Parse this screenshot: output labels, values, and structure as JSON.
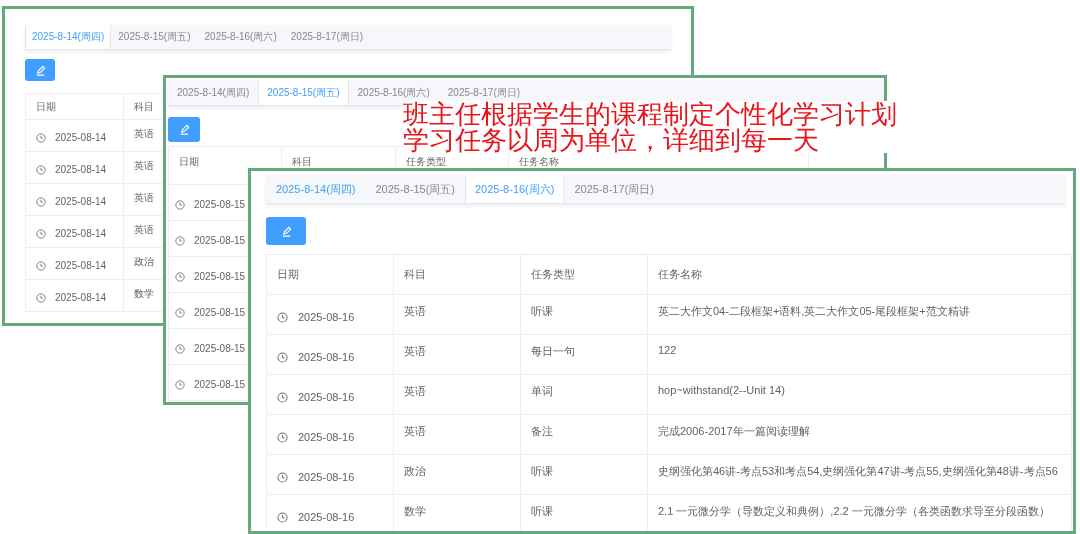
{
  "windows": [
    {
      "tabs": [
        {
          "label": "2025-8-14(周四)",
          "selected": true,
          "hovered": false
        },
        {
          "label": "2025-8-15(周五)",
          "selected": false,
          "hovered": false
        },
        {
          "label": "2025-8-16(周六)",
          "selected": false,
          "hovered": false
        },
        {
          "label": "2025-8-17(周日)",
          "selected": false,
          "hovered": false
        }
      ],
      "columns": [
        "日期",
        "科目"
      ],
      "rows": [
        [
          "2025-08-14",
          "英语"
        ],
        [
          "2025-08-14",
          "英语"
        ],
        [
          "2025-08-14",
          "英语"
        ],
        [
          "2025-08-14",
          "英语"
        ],
        [
          "2025-08-14",
          "政治"
        ],
        [
          "2025-08-14",
          "数学"
        ]
      ]
    },
    {
      "tabs": [
        {
          "label": "2025-8-14(周四)",
          "selected": false,
          "hovered": false
        },
        {
          "label": "2025-8-15(周五)",
          "selected": true,
          "hovered": false
        },
        {
          "label": "2025-8-16(周六)",
          "selected": false,
          "hovered": false
        },
        {
          "label": "2025-8-17(周日)",
          "selected": false,
          "hovered": false
        }
      ],
      "columns": [
        "日期",
        "科目",
        "任务类型",
        "任务名称"
      ],
      "rows": [
        [
          "2025-08-15"
        ],
        [
          "2025-08-15"
        ],
        [
          "2025-08-15"
        ],
        [
          "2025-08-15"
        ],
        [
          "2025-08-15"
        ],
        [
          "2025-08-15"
        ]
      ]
    },
    {
      "tabs": [
        {
          "label": "2025-8-14(周四)",
          "selected": false,
          "hovered": true
        },
        {
          "label": "2025-8-15(周五)",
          "selected": false,
          "hovered": false
        },
        {
          "label": "2025-8-16(周六)",
          "selected": true,
          "hovered": false
        },
        {
          "label": "2025-8-17(周日)",
          "selected": false,
          "hovered": false
        }
      ],
      "columns": [
        "日期",
        "科目",
        "任务类型",
        "任务名称"
      ],
      "rows": [
        [
          "2025-08-16",
          "英语",
          "听课",
          "英二大作文04-二段框架+语料,英二大作文05-尾段框架+范文精讲"
        ],
        [
          "2025-08-16",
          "英语",
          "每日一句",
          "122"
        ],
        [
          "2025-08-16",
          "英语",
          "单词",
          "hop~withstand(2--Unit 14)"
        ],
        [
          "2025-08-16",
          "英语",
          "备注",
          "完成2006-2017年一篇阅读理解"
        ],
        [
          "2025-08-16",
          "政治",
          "听课",
          "史纲强化第46讲-考点53和考点54,史纲强化第47讲-考点55,史纲强化第48讲-考点56"
        ],
        [
          "2025-08-16",
          "数学",
          "听课",
          "2.1 一元微分学（导数定义和典例）,2.2 一元微分学（各类函数求导至分段函数）"
        ]
      ]
    }
  ],
  "annotation": [
    "班主任根据学生的课程制定个性化学习计划",
    "学习任务以周为单位，详细到每一天"
  ]
}
